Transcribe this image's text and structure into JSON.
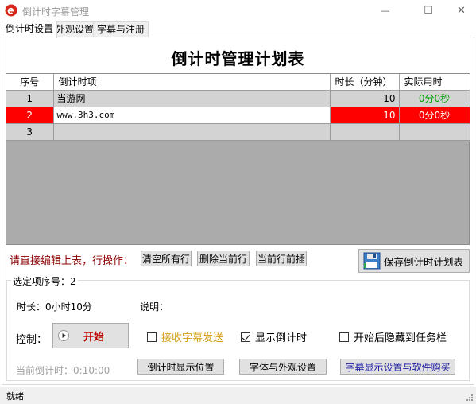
{
  "window": {
    "title": "倒计时字幕管理",
    "minimize_glyph": "—",
    "maximize_glyph": "☐",
    "close_glyph": "✕"
  },
  "tabs": [
    {
      "label": "倒计时设置",
      "active": true
    },
    {
      "label": "外观设置",
      "active": false
    },
    {
      "label": "字幕与注册",
      "active": false
    }
  ],
  "heading": "倒计时管理计划表",
  "grid": {
    "columns": [
      "序号",
      "倒计时项",
      "时长（分钟）",
      "实际用时"
    ],
    "rows": [
      {
        "index": "1",
        "item": "当游网",
        "duration": "10",
        "actual": "0分0秒"
      },
      {
        "index": "2",
        "item": "www.3h3.com",
        "duration": "10",
        "actual": "0分0秒"
      },
      {
        "index": "3",
        "item": "",
        "duration": "",
        "actual": ""
      }
    ]
  },
  "actions": {
    "prompt": "请直接编辑上表，行操作：",
    "clear_all": "清空所有行",
    "delete_row": "删除当前行",
    "insert_row": "当前行前插",
    "save_plan": "保存倒计时计划表"
  },
  "selection": {
    "group_title": "选定项序号：2",
    "duration": "时长：0小时10分",
    "note_label": "说明：",
    "control_label": "控制：",
    "start_label": "开始",
    "receive_subtitle": "接收字幕发送",
    "show_countdown": "显示倒计时",
    "hide_taskbar": "开始后隐藏到任务栏",
    "current_countdown": "当前倒计时：0:10:00",
    "btn_display_pos": "倒计时显示位置",
    "btn_font": "字体与外观设置",
    "btn_subtitle": "字幕显示设置与软件购买",
    "receive_subtitle_checked": false,
    "show_countdown_checked": true,
    "hide_taskbar_checked": false
  },
  "status": {
    "text": "就绪"
  },
  "colors": {
    "selected_row": "#ff0000",
    "actual_time_green": "#00a000",
    "prompt_red": "#8b0000",
    "start_red": "#c00000",
    "receive_orange": "#d4a017",
    "subtitle_button_blue": "#1a1aa0"
  }
}
